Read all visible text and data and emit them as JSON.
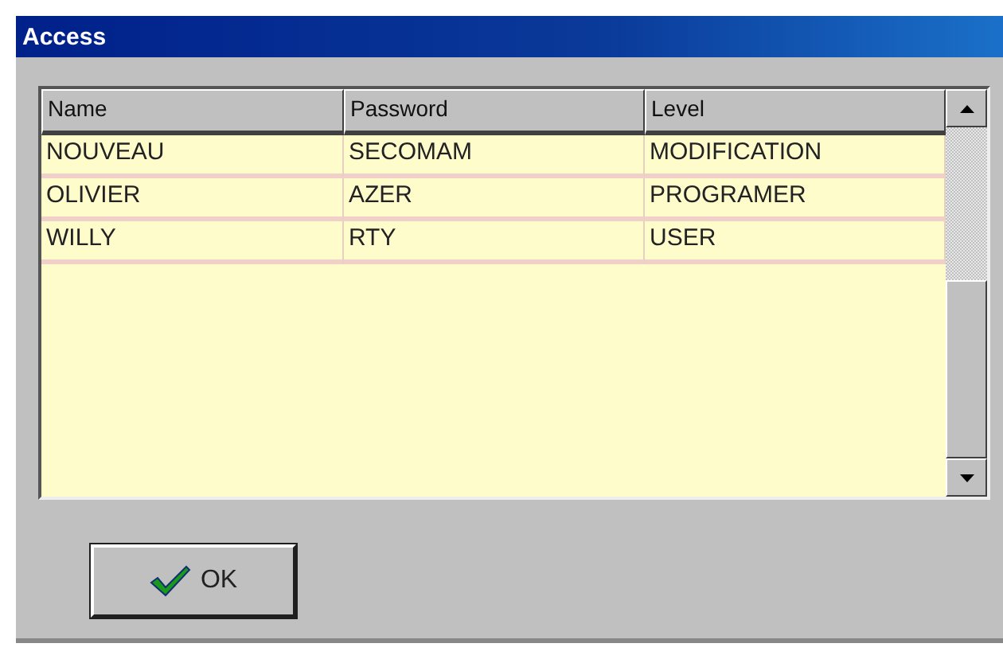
{
  "window": {
    "title": "Access"
  },
  "table": {
    "columns": [
      "Name",
      "Password",
      "Level"
    ],
    "rows": [
      [
        "NOUVEAU",
        "SECOMAM",
        "MODIFICATION"
      ],
      [
        "OLIVIER",
        "AZER",
        "PROGRAMER"
      ],
      [
        "WILLY",
        "RTY",
        "USER"
      ]
    ]
  },
  "buttons": [
    {
      "label": "OK"
    }
  ]
}
